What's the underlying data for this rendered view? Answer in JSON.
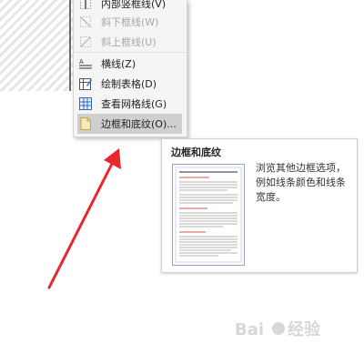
{
  "menu": {
    "items": [
      {
        "label": "内部竖框线(V)",
        "icon": "inside-vertical-border-icon",
        "disabled": false
      },
      {
        "label": "斜下框线(W)",
        "icon": "diagonal-down-border-icon",
        "disabled": true
      },
      {
        "label": "斜上框线(U)",
        "icon": "diagonal-up-border-icon",
        "disabled": true
      },
      {
        "label": "横线(Z)",
        "icon": "horizontal-line-icon",
        "disabled": false
      },
      {
        "label": "绘制表格(D)",
        "icon": "draw-table-icon",
        "disabled": false
      },
      {
        "label": "查看网格线(G)",
        "icon": "view-gridlines-icon",
        "disabled": false
      },
      {
        "label": "边框和底纹(O)...",
        "icon": "borders-shading-icon",
        "disabled": false,
        "active": true
      }
    ]
  },
  "tooltip": {
    "title": "边框和底纹",
    "description": "浏览其他边框选项，例如线条颜色和线条宽度。"
  },
  "colors": {
    "arrow": "#e8262d",
    "menu_bg": "#f5f5f5",
    "active_bg": "#cfcfcf"
  }
}
